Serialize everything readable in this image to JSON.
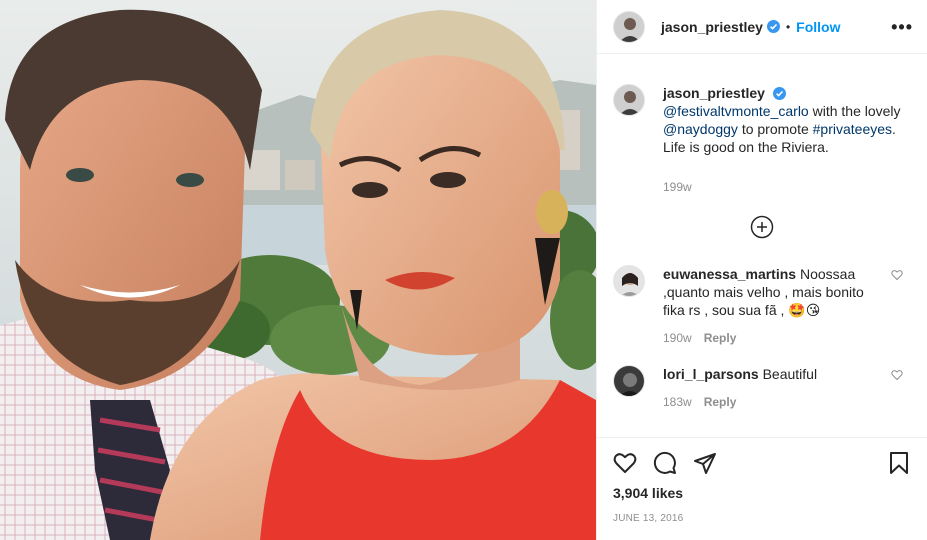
{
  "post": {
    "photo_alt": "Selfie of a man in a checked shirt and tie and a woman in a red top",
    "author": {
      "username": "jason_priestley",
      "verified": true,
      "follow_label": "Follow",
      "separator": "•",
      "more_label": "•••"
    },
    "caption": {
      "username": "jason_priestley",
      "mention1": "@festivaltvmonte_carlo",
      "text1": " with the lovely ",
      "mention2": "@naydoggy",
      "text2": " to promote ",
      "hashtag": "#privateeyes",
      "text3": ". Life is good on the Riviera.",
      "time": "199w"
    },
    "comments": [
      {
        "username": "euwanessa_martins",
        "text": "Noossaa ,quanto mais velho , mais bonito fika rs , sou sua fã , 🤩😘",
        "time": "190w",
        "reply_label": "Reply"
      },
      {
        "username": "lori_l_parsons",
        "text": "Beautiful",
        "time": "183w",
        "reply_label": "Reply"
      }
    ],
    "likes": "3,904 likes",
    "date": "JUNE 13, 2016",
    "colors": {
      "link": "#0095f6",
      "mention": "#00376b",
      "muted": "#8e8e8e",
      "text": "#262626",
      "dress": "#e8382e"
    }
  }
}
